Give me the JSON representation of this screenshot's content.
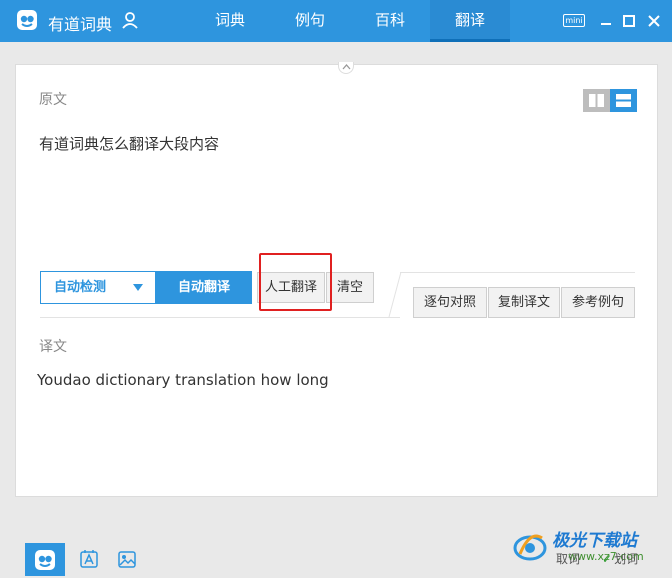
{
  "app": {
    "title": "有道词典"
  },
  "nav": {
    "tabs": [
      {
        "label": "词典"
      },
      {
        "label": "例句"
      },
      {
        "label": "百科"
      },
      {
        "label": "翻译"
      }
    ],
    "active_index": 3
  },
  "window": {
    "mini_label": "mini"
  },
  "source": {
    "label": "原文",
    "text": "有道词典怎么翻译大段内容"
  },
  "toolbar": {
    "lang_select": "自动检测",
    "translate_button": "自动翻译",
    "human_button": "人工翻译",
    "clear_button": "清空",
    "compare_button": "逐句对照",
    "copy_button": "复制译文",
    "example_button": "参考例句"
  },
  "result": {
    "label": "译文",
    "text": "Youdao dictionary translation how long"
  },
  "bottom": {
    "take_word": "取词",
    "select_word": "划词"
  },
  "watermark": {
    "title": "极光下载站",
    "url": "www.xz7.com"
  },
  "colors": {
    "brand": "#2e95de",
    "highlight": "#e02020"
  }
}
